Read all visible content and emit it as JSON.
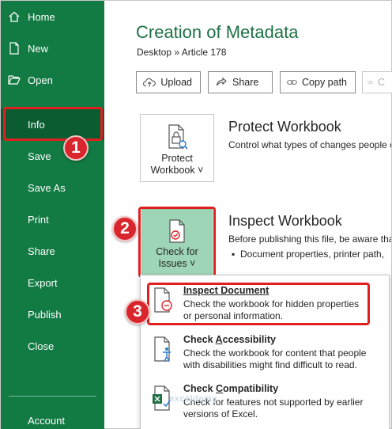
{
  "sidebar": {
    "items": [
      {
        "label": "Home",
        "icon": "home-icon"
      },
      {
        "label": "New",
        "icon": "new-file-icon"
      },
      {
        "label": "Open",
        "icon": "open-folder-icon"
      },
      {
        "label": "Info"
      },
      {
        "label": "Save"
      },
      {
        "label": "Save As"
      },
      {
        "label": "Print"
      },
      {
        "label": "Share"
      },
      {
        "label": "Export"
      },
      {
        "label": "Publish"
      },
      {
        "label": "Close"
      },
      {
        "label": "Account"
      }
    ]
  },
  "main": {
    "title": "Creation of Metadata",
    "breadcrumb": "Desktop » Article 178",
    "toolbar": {
      "upload_label": "Upload",
      "share_label": "Share",
      "copy_path_label": "Copy path",
      "faded_label": "C"
    },
    "protect": {
      "button_line1": "Protect",
      "button_line2": "Workbook",
      "title": "Protect Workbook",
      "description": "Control what types of changes people c"
    },
    "inspect": {
      "button_line1": "Check for",
      "button_line2": "Issues",
      "title": "Inspect Workbook",
      "description": "Before publishing this file, be aware tha",
      "bullet": "Document properties, printer path,"
    }
  },
  "dropdown": {
    "items": [
      {
        "title": "Inspect Document",
        "desc_line1": "Check the workbook for hidden properties",
        "desc_line2": "or personal information."
      },
      {
        "title_prefix": "Check ",
        "title_underlined": "A",
        "title_suffix": "ccessibility",
        "desc_line1": "Check the workbook for content that people",
        "desc_line2": "with disabilities might find difficult to read."
      },
      {
        "title_prefix": "Check ",
        "title_underlined": "C",
        "title_suffix": "ompatibility",
        "desc_line1": "Check for features not supported by earlier",
        "desc_line2": "versions of Excel."
      }
    ]
  },
  "callouts": [
    "1",
    "2",
    "3"
  ],
  "watermark": "exceldemy",
  "colors": {
    "sidebar_green": "#127a43",
    "info_selected": "#0b5c31",
    "title_green": "#1e7145",
    "highlight_red": "#e02020",
    "badge_red": "#d9262c",
    "check_issues_bg": "#9fd5b7"
  }
}
